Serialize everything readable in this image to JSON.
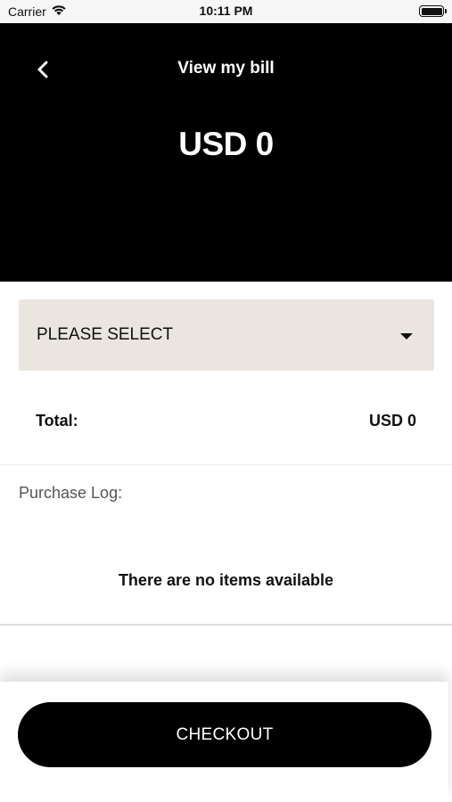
{
  "status_bar": {
    "carrier": "Carrier",
    "time": "10:11 PM"
  },
  "header": {
    "title": "View my bill",
    "amount": "USD 0"
  },
  "select": {
    "value": "PLEASE SELECT"
  },
  "summary": {
    "total_label": "Total:",
    "total_value": "USD 0"
  },
  "purchase_log": {
    "label": "Purchase Log:",
    "empty_message": "There are no items available"
  },
  "footer": {
    "checkout_label": "CHECKOUT"
  },
  "colors": {
    "hero_background": "#000000",
    "select_background": "#ebe5df",
    "button_background": "#000000"
  }
}
